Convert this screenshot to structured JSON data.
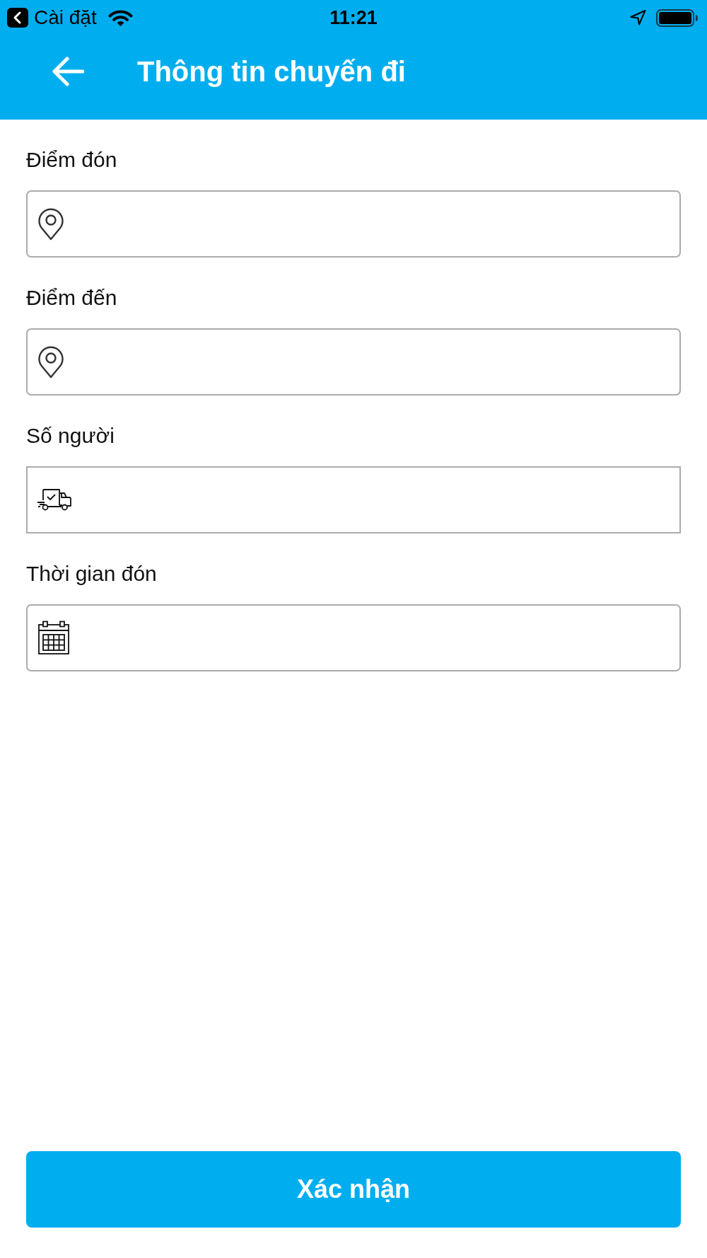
{
  "status_bar": {
    "back_app": "Cài đặt",
    "time": "11:21"
  },
  "header": {
    "title": "Thông tin chuyến đi"
  },
  "fields": [
    {
      "label": "Điểm đón",
      "kind": "place",
      "rounded": true
    },
    {
      "label": "Điểm đến",
      "kind": "place",
      "rounded": true
    },
    {
      "label": "Số người",
      "kind": "people",
      "rounded": false
    },
    {
      "label": "Thời gian đón",
      "kind": "time",
      "rounded": true
    }
  ],
  "submit_button": {
    "label": "Xác nhận"
  }
}
